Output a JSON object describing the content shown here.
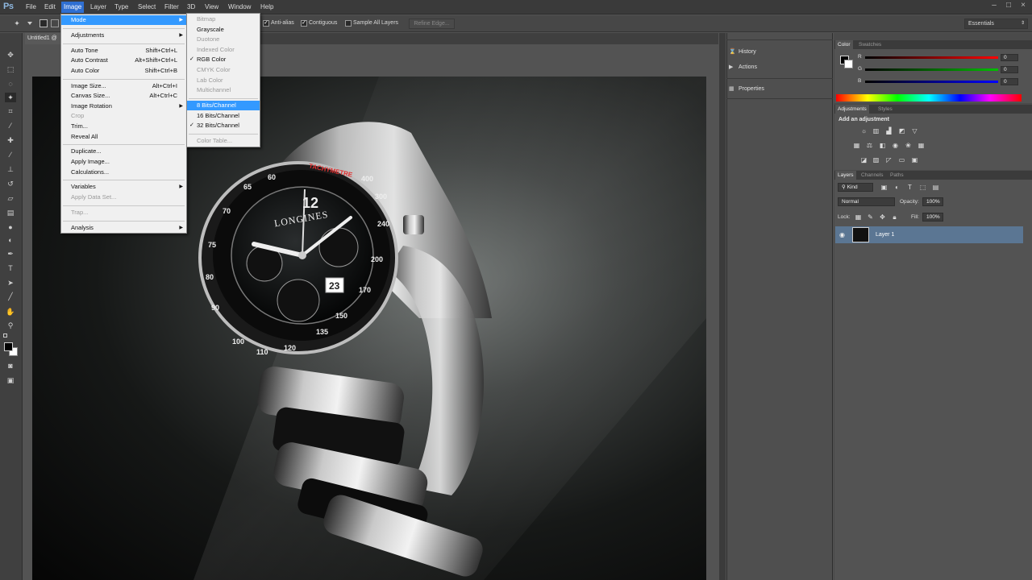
{
  "app": {
    "logo": "Ps"
  },
  "menubar": {
    "items": [
      "File",
      "Edit",
      "Image",
      "Layer",
      "Type",
      "Select",
      "Filter",
      "3D",
      "View",
      "Window",
      "Help"
    ],
    "active": "Image"
  },
  "options_bar": {
    "antialias_label": "Anti-alias",
    "contiguous_label": "Contiguous",
    "sample_all_label": "Sample All Layers",
    "refine_edge_label": "Refine Edge...",
    "workspace_label": "Essentials"
  },
  "document_tab": {
    "label": "Untitled1 @"
  },
  "image_menu": [
    {
      "label": "Mode",
      "highlighted": true,
      "submenu": true
    },
    {
      "separator": true
    },
    {
      "label": "Adjustments",
      "submenu": true
    },
    {
      "separator": true
    },
    {
      "label": "Auto Tone",
      "shortcut": "Shift+Ctrl+L"
    },
    {
      "label": "Auto Contrast",
      "shortcut": "Alt+Shift+Ctrl+L"
    },
    {
      "label": "Auto Color",
      "shortcut": "Shift+Ctrl+B"
    },
    {
      "separator": true
    },
    {
      "label": "Image Size...",
      "shortcut": "Alt+Ctrl+I"
    },
    {
      "label": "Canvas Size...",
      "shortcut": "Alt+Ctrl+C"
    },
    {
      "label": "Image Rotation",
      "submenu": true
    },
    {
      "label": "Crop",
      "disabled": true
    },
    {
      "label": "Trim..."
    },
    {
      "label": "Reveal All"
    },
    {
      "separator": true
    },
    {
      "label": "Duplicate..."
    },
    {
      "label": "Apply Image..."
    },
    {
      "label": "Calculations..."
    },
    {
      "separator": true
    },
    {
      "label": "Variables",
      "submenu": true
    },
    {
      "label": "Apply Data Set...",
      "disabled": true
    },
    {
      "separator": true
    },
    {
      "label": "Trap...",
      "disabled": true
    },
    {
      "separator": true
    },
    {
      "label": "Analysis",
      "submenu": true
    }
  ],
  "mode_submenu": [
    {
      "label": "Bitmap",
      "disabled": true
    },
    {
      "label": "Grayscale"
    },
    {
      "label": "Duotone",
      "disabled": true
    },
    {
      "label": "Indexed Color",
      "disabled": true
    },
    {
      "label": "RGB Color",
      "checked": true
    },
    {
      "label": "CMYK Color",
      "disabled": true
    },
    {
      "label": "Lab Color",
      "disabled": true
    },
    {
      "label": "Multichannel",
      "disabled": true
    },
    {
      "separator": true
    },
    {
      "label": "8 Bits/Channel",
      "highlighted": true
    },
    {
      "label": "16 Bits/Channel"
    },
    {
      "label": "32 Bits/Channel",
      "checked": true
    },
    {
      "separator": true
    },
    {
      "label": "Color Table...",
      "disabled": true
    }
  ],
  "mid_panel": {
    "history": "History",
    "actions": "Actions",
    "properties": "Properties"
  },
  "color_panel": {
    "tabs": [
      "Color",
      "Swatches"
    ],
    "channels": [
      {
        "label": "R",
        "value": "0",
        "color": "#ff0000"
      },
      {
        "label": "G",
        "value": "0",
        "color": "#00c000"
      },
      {
        "label": "B",
        "value": "0",
        "color": "#0000ff"
      }
    ]
  },
  "adjustments_panel": {
    "tabs": [
      "Adjustments",
      "Styles"
    ],
    "heading": "Add an adjustment"
  },
  "layers_panel": {
    "tabs": [
      "Layers",
      "Channels",
      "Paths"
    ],
    "filter_label": "Kind",
    "blend_mode": "Normal",
    "opacity_label": "Opacity:",
    "opacity_value": "100%",
    "lock_label": "Lock:",
    "fill_label": "Fill:",
    "fill_value": "100%",
    "layer_name": "Layer 1"
  },
  "colors": {
    "accent": "#3399ff",
    "selected_layer": "#5b7693"
  }
}
